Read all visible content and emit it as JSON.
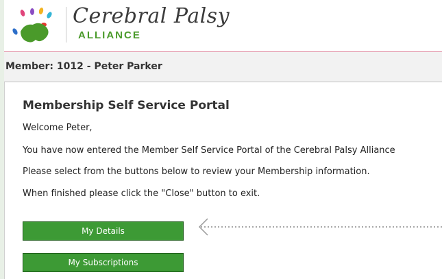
{
  "header": {
    "logo": {
      "name": "Cerebral Palsy",
      "sub": "ALLIANCE"
    }
  },
  "member_bar": {
    "text": "Member: 1012 - Peter Parker"
  },
  "portal": {
    "title": "Membership Self Service Portal",
    "welcome": "Welcome Peter,",
    "intro": "You have now entered the Member Self Service Portal of the Cerebral Palsy Alliance",
    "instruction": "Please select from the buttons below to review your Membership information.",
    "close_note": "When finished please click the \"Close\" button to exit."
  },
  "buttons": {
    "my_details": "My Details",
    "my_subscriptions": "My Subscriptions"
  },
  "colors": {
    "button_green": "#3d9a35",
    "logo_green": "#4a9a2a",
    "header_rule": "#e08aa0"
  }
}
